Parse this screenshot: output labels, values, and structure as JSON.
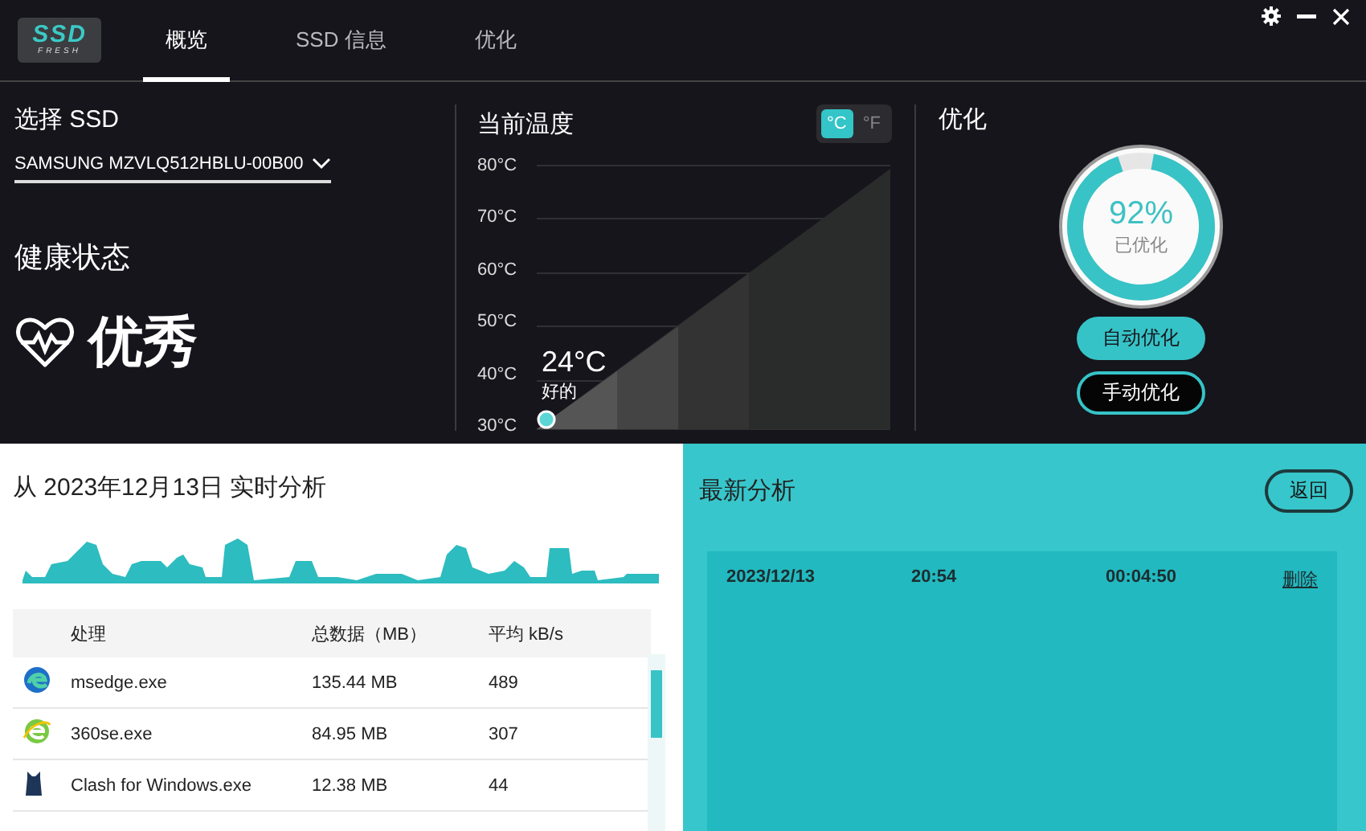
{
  "logo": {
    "title": "SSD",
    "subtitle": "FRESH"
  },
  "tabs": [
    {
      "label": "概览",
      "selected": true
    },
    {
      "label": "SSD 信息",
      "selected": false
    },
    {
      "label": "优化",
      "selected": false
    }
  ],
  "drive": {
    "label": "选择 SSD",
    "value": "SAMSUNG MZVLQ512HBLU-00B00"
  },
  "health": {
    "label": "健康状态",
    "value": "优秀"
  },
  "temperature": {
    "title": "当前温度",
    "units": [
      {
        "label": "°C",
        "selected": true
      },
      {
        "label": "°F",
        "selected": false
      }
    ],
    "scale": [
      "80°C",
      "70°C",
      "60°C",
      "50°C",
      "40°C",
      "30°C"
    ],
    "reading": "24°C",
    "status": "好的"
  },
  "optimization": {
    "title": "优化",
    "level": 0.92,
    "percent": "92%",
    "caption": "已优化",
    "buttons": [
      {
        "label": "自动优化",
        "kind": "primary"
      },
      {
        "label": "手动优化",
        "kind": "outline"
      }
    ]
  },
  "analysis": {
    "title": "从 2023年12月13日 实时分析",
    "columns": [
      "处理",
      "总数据（MB）",
      "平均 kB/s"
    ],
    "rows": [
      {
        "kind": "swirl",
        "name": "msedge.exe",
        "total": "135.44 MB",
        "average": "489"
      },
      {
        "kind": "letter",
        "name": "360se.exe",
        "total": "84.95 MB",
        "average": "307"
      },
      {
        "kind": "figure",
        "name": "Clash for Windows.exe",
        "total": "12.38 MB",
        "average": "44"
      }
    ]
  },
  "latest": {
    "title": "最新分析",
    "back": "返回",
    "rows": [
      {
        "date": "2023/12/13",
        "time": "20:54",
        "duration": "00:04:50",
        "action": "删除"
      }
    ]
  }
}
